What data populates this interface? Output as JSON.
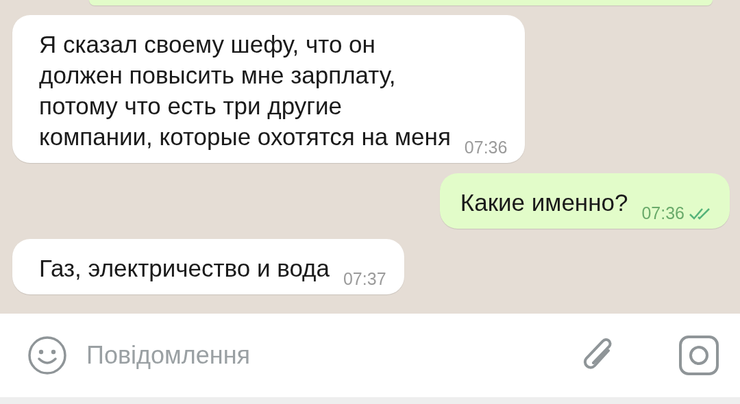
{
  "messages": [
    {
      "kind": "incoming",
      "text": "Я сказал своему шефу, что он\nдолжен повысить мне зарплату,\nпотому что есть три другие\nкомпании, которые охотятся на меня",
      "time": "07:36"
    },
    {
      "kind": "outgoing",
      "text": "Какие именно?",
      "time": "07:36",
      "read": true
    },
    {
      "kind": "incoming",
      "text": "Газ, электричество и вода",
      "time": "07:37"
    }
  ],
  "composer": {
    "placeholder": "Повідомлення"
  }
}
